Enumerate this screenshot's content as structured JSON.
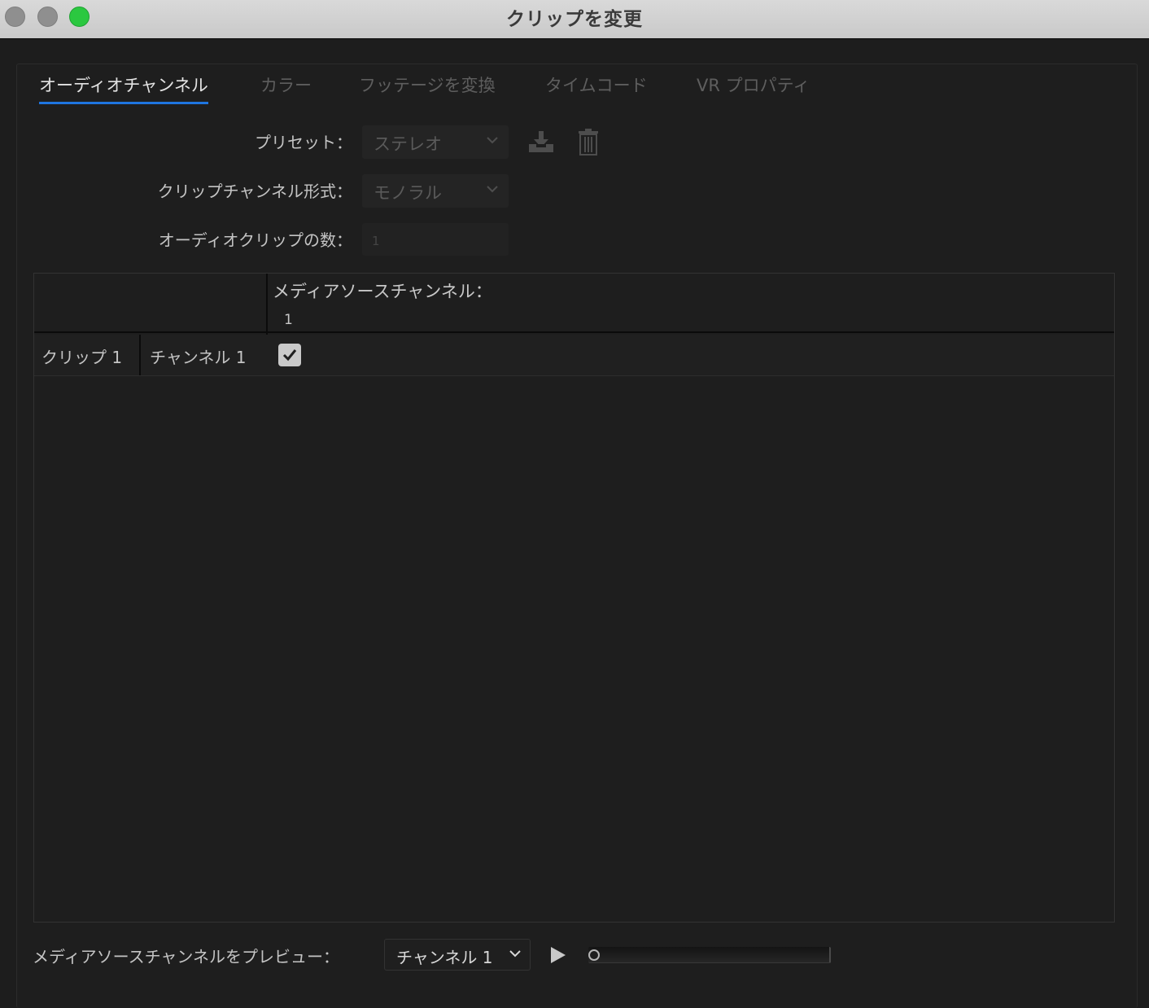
{
  "window": {
    "title": "クリップを変更"
  },
  "tabs": [
    {
      "label": "オーディオチャンネル",
      "active": true
    },
    {
      "label": "カラー",
      "active": false
    },
    {
      "label": "フッテージを変換",
      "active": false
    },
    {
      "label": "タイムコード",
      "active": false
    },
    {
      "label": "VR プロパティ",
      "active": false
    }
  ],
  "form": {
    "preset": {
      "label": "プリセット：",
      "value": "ステレオ"
    },
    "clip_channel_format": {
      "label": "クリップチャンネル形式：",
      "value": "モノラル"
    },
    "audio_clip_count": {
      "label": "オーディオクリップの数：",
      "value": "1"
    }
  },
  "icons": {
    "save_preset": "download-icon",
    "delete_preset": "trash-icon",
    "dropdown": "chevron-down-icon",
    "play": "play-icon",
    "check": "checkmark-icon"
  },
  "grid": {
    "header_label": "メディアソースチャンネル：",
    "source_channels": [
      "1"
    ],
    "rows": [
      {
        "clip": "クリップ 1",
        "channel": "チャンネル 1",
        "checked": true
      }
    ]
  },
  "footer": {
    "preview_label": "メディアソースチャンネルをプレビュー：",
    "preview_channel": "チャンネル 1",
    "playback_progress": 0
  },
  "colors": {
    "accent": "#1f75e0",
    "zoom_button": "#2bc840",
    "background": "#1e1e1e"
  }
}
